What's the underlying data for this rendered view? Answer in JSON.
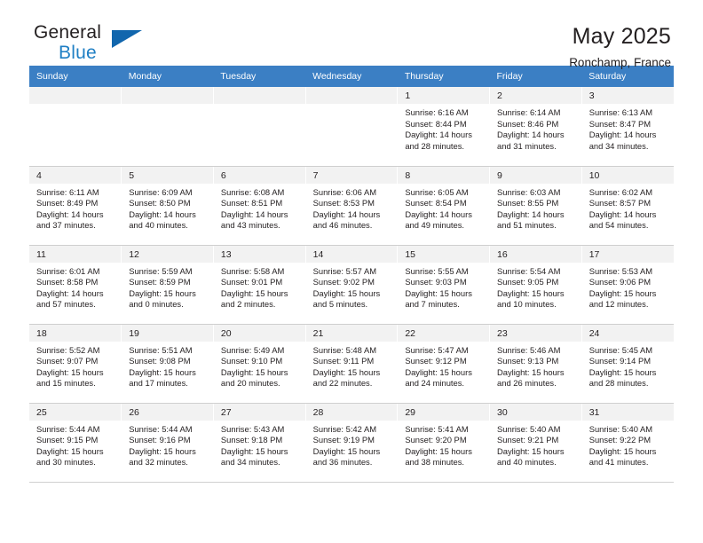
{
  "brand": {
    "name_part1": "General",
    "name_part2": "Blue",
    "flag_icon": "blue-triangle-flag-icon"
  },
  "header": {
    "title": "May 2025",
    "location": "Ronchamp, France"
  },
  "theme": {
    "header_blue": "#3b7fc4",
    "brand_blue": "#1f7fc4",
    "flag_blue": "#1166ad",
    "daynum_bg": "#f2f2f2",
    "shade_bg": "#f3f3f3",
    "text": "#231f20",
    "grid_line": "#cfcfcf"
  },
  "weekday_headers": [
    "Sunday",
    "Monday",
    "Tuesday",
    "Wednesday",
    "Thursday",
    "Friday",
    "Saturday"
  ],
  "weeks": [
    [
      {
        "day": "",
        "sunrise": "",
        "sunset": "",
        "daylight1": "",
        "daylight2": ""
      },
      {
        "day": "",
        "sunrise": "",
        "sunset": "",
        "daylight1": "",
        "daylight2": ""
      },
      {
        "day": "",
        "sunrise": "",
        "sunset": "",
        "daylight1": "",
        "daylight2": ""
      },
      {
        "day": "",
        "sunrise": "",
        "sunset": "",
        "daylight1": "",
        "daylight2": ""
      },
      {
        "day": "1",
        "sunrise": "Sunrise: 6:16 AM",
        "sunset": "Sunset: 8:44 PM",
        "daylight1": "Daylight: 14 hours",
        "daylight2": "and 28 minutes."
      },
      {
        "day": "2",
        "sunrise": "Sunrise: 6:14 AM",
        "sunset": "Sunset: 8:46 PM",
        "daylight1": "Daylight: 14 hours",
        "daylight2": "and 31 minutes."
      },
      {
        "day": "3",
        "sunrise": "Sunrise: 6:13 AM",
        "sunset": "Sunset: 8:47 PM",
        "daylight1": "Daylight: 14 hours",
        "daylight2": "and 34 minutes."
      }
    ],
    [
      {
        "day": "4",
        "sunrise": "Sunrise: 6:11 AM",
        "sunset": "Sunset: 8:49 PM",
        "daylight1": "Daylight: 14 hours",
        "daylight2": "and 37 minutes."
      },
      {
        "day": "5",
        "sunrise": "Sunrise: 6:09 AM",
        "sunset": "Sunset: 8:50 PM",
        "daylight1": "Daylight: 14 hours",
        "daylight2": "and 40 minutes."
      },
      {
        "day": "6",
        "sunrise": "Sunrise: 6:08 AM",
        "sunset": "Sunset: 8:51 PM",
        "daylight1": "Daylight: 14 hours",
        "daylight2": "and 43 minutes."
      },
      {
        "day": "7",
        "sunrise": "Sunrise: 6:06 AM",
        "sunset": "Sunset: 8:53 PM",
        "daylight1": "Daylight: 14 hours",
        "daylight2": "and 46 minutes."
      },
      {
        "day": "8",
        "sunrise": "Sunrise: 6:05 AM",
        "sunset": "Sunset: 8:54 PM",
        "daylight1": "Daylight: 14 hours",
        "daylight2": "and 49 minutes."
      },
      {
        "day": "9",
        "sunrise": "Sunrise: 6:03 AM",
        "sunset": "Sunset: 8:55 PM",
        "daylight1": "Daylight: 14 hours",
        "daylight2": "and 51 minutes."
      },
      {
        "day": "10",
        "sunrise": "Sunrise: 6:02 AM",
        "sunset": "Sunset: 8:57 PM",
        "daylight1": "Daylight: 14 hours",
        "daylight2": "and 54 minutes."
      }
    ],
    [
      {
        "day": "11",
        "sunrise": "Sunrise: 6:01 AM",
        "sunset": "Sunset: 8:58 PM",
        "daylight1": "Daylight: 14 hours",
        "daylight2": "and 57 minutes."
      },
      {
        "day": "12",
        "sunrise": "Sunrise: 5:59 AM",
        "sunset": "Sunset: 8:59 PM",
        "daylight1": "Daylight: 15 hours",
        "daylight2": "and 0 minutes."
      },
      {
        "day": "13",
        "sunrise": "Sunrise: 5:58 AM",
        "sunset": "Sunset: 9:01 PM",
        "daylight1": "Daylight: 15 hours",
        "daylight2": "and 2 minutes."
      },
      {
        "day": "14",
        "sunrise": "Sunrise: 5:57 AM",
        "sunset": "Sunset: 9:02 PM",
        "daylight1": "Daylight: 15 hours",
        "daylight2": "and 5 minutes."
      },
      {
        "day": "15",
        "sunrise": "Sunrise: 5:55 AM",
        "sunset": "Sunset: 9:03 PM",
        "daylight1": "Daylight: 15 hours",
        "daylight2": "and 7 minutes."
      },
      {
        "day": "16",
        "sunrise": "Sunrise: 5:54 AM",
        "sunset": "Sunset: 9:05 PM",
        "daylight1": "Daylight: 15 hours",
        "daylight2": "and 10 minutes."
      },
      {
        "day": "17",
        "sunrise": "Sunrise: 5:53 AM",
        "sunset": "Sunset: 9:06 PM",
        "daylight1": "Daylight: 15 hours",
        "daylight2": "and 12 minutes."
      }
    ],
    [
      {
        "day": "18",
        "sunrise": "Sunrise: 5:52 AM",
        "sunset": "Sunset: 9:07 PM",
        "daylight1": "Daylight: 15 hours",
        "daylight2": "and 15 minutes."
      },
      {
        "day": "19",
        "sunrise": "Sunrise: 5:51 AM",
        "sunset": "Sunset: 9:08 PM",
        "daylight1": "Daylight: 15 hours",
        "daylight2": "and 17 minutes."
      },
      {
        "day": "20",
        "sunrise": "Sunrise: 5:49 AM",
        "sunset": "Sunset: 9:10 PM",
        "daylight1": "Daylight: 15 hours",
        "daylight2": "and 20 minutes."
      },
      {
        "day": "21",
        "sunrise": "Sunrise: 5:48 AM",
        "sunset": "Sunset: 9:11 PM",
        "daylight1": "Daylight: 15 hours",
        "daylight2": "and 22 minutes."
      },
      {
        "day": "22",
        "sunrise": "Sunrise: 5:47 AM",
        "sunset": "Sunset: 9:12 PM",
        "daylight1": "Daylight: 15 hours",
        "daylight2": "and 24 minutes."
      },
      {
        "day": "23",
        "sunrise": "Sunrise: 5:46 AM",
        "sunset": "Sunset: 9:13 PM",
        "daylight1": "Daylight: 15 hours",
        "daylight2": "and 26 minutes."
      },
      {
        "day": "24",
        "sunrise": "Sunrise: 5:45 AM",
        "sunset": "Sunset: 9:14 PM",
        "daylight1": "Daylight: 15 hours",
        "daylight2": "and 28 minutes."
      }
    ],
    [
      {
        "day": "25",
        "sunrise": "Sunrise: 5:44 AM",
        "sunset": "Sunset: 9:15 PM",
        "daylight1": "Daylight: 15 hours",
        "daylight2": "and 30 minutes."
      },
      {
        "day": "26",
        "sunrise": "Sunrise: 5:44 AM",
        "sunset": "Sunset: 9:16 PM",
        "daylight1": "Daylight: 15 hours",
        "daylight2": "and 32 minutes."
      },
      {
        "day": "27",
        "sunrise": "Sunrise: 5:43 AM",
        "sunset": "Sunset: 9:18 PM",
        "daylight1": "Daylight: 15 hours",
        "daylight2": "and 34 minutes."
      },
      {
        "day": "28",
        "sunrise": "Sunrise: 5:42 AM",
        "sunset": "Sunset: 9:19 PM",
        "daylight1": "Daylight: 15 hours",
        "daylight2": "and 36 minutes."
      },
      {
        "day": "29",
        "sunrise": "Sunrise: 5:41 AM",
        "sunset": "Sunset: 9:20 PM",
        "daylight1": "Daylight: 15 hours",
        "daylight2": "and 38 minutes."
      },
      {
        "day": "30",
        "sunrise": "Sunrise: 5:40 AM",
        "sunset": "Sunset: 9:21 PM",
        "daylight1": "Daylight: 15 hours",
        "daylight2": "and 40 minutes."
      },
      {
        "day": "31",
        "sunrise": "Sunrise: 5:40 AM",
        "sunset": "Sunset: 9:22 PM",
        "daylight1": "Daylight: 15 hours",
        "daylight2": "and 41 minutes."
      }
    ]
  ]
}
